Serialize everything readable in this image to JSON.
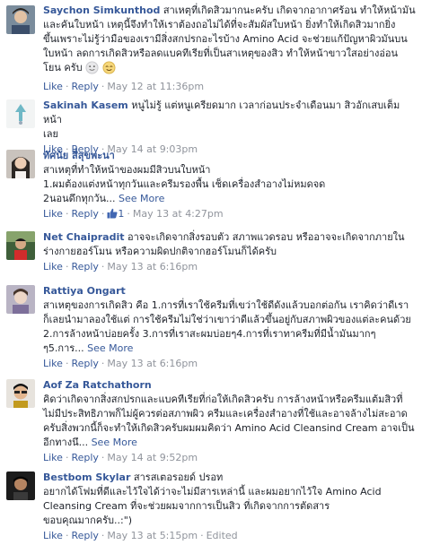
{
  "comments": [
    {
      "name": "Saychon Simkunthod",
      "lines": [
        "สาเหตุที่เกิดสิวมากนะครับ เกิดจากอากาศร้อน ทำให้หน้ามัน",
        "และคันใบหน้า เหตุนี้จึงทำให้เราต้องถอไม่ได้ที่จะสัมผัสใบหน้า ยิ่งทำให้เกิดสิวมากยิ่ง",
        "ขึ้นเพราะไม่รู้ว่ามือของเรามีสิ่งสกปรกอะไรบ้าง Amino Acid จะช่วยแก้ปัญหาผิวมันบน",
        "ใบหน้า ลดการเกิดสิวหรือลดแบคทีเรียที่เป็นสาเหตุของสิว ทำให้หน้าขาวใสอย่างอ่อน",
        "โยน ครับ"
      ],
      "like": "Like",
      "reply": "Reply",
      "time": "May 12 at 11:36pm"
    },
    {
      "name": "Sakinah Kasem",
      "lines": [
        "หนูไม่รู้ แต่หนูเครียดมาก เวลาก่อนประจำเดือนมา สิวอักเสบเต็มหน้า",
        "เลย"
      ],
      "like": "Like",
      "reply": "Reply",
      "time": "May 14 at 9:03pm"
    },
    {
      "name": "ทัศนัย สี่สุขพะนา",
      "lines": [
        "สาเหตุที่ทำให้หน้าของผมมีสิวบนใบหน้า",
        "1.ผมต้องแต่งหน้าทุกวันและครีมรองพื้น เช็ดเครื่องสำอางไม่หมดจด",
        "2นอนดึกทุกวัน..."
      ],
      "see_more": "See More",
      "like": "Like",
      "reply": "Reply",
      "like_count": "1",
      "time": "May 13 at 4:27pm"
    },
    {
      "name": "Net Chaipradit",
      "lines": [
        "อาจจะเกิดจากสิ่งรอบตัว สภาพแวดรอบ หรืออาจจะเกิดจากภายใน",
        "ร่างกายฮอร์โมน หรือความผิดปกติจากฮอร์โมนก็ได้ครับ"
      ],
      "like": "Like",
      "reply": "Reply",
      "time": "May 13 at 6:16pm"
    },
    {
      "name": "Rattiya Ongart",
      "lines": [
        "สาเหตุของการเกิดสิว คือ 1.การที่เราใช้ครีมที่เขว่าใช้ดีดังแล้วบอกต่อกัน เราคิดว่าดีเรา",
        "ก็เลยนำมาลองใช้แต่ การใช้ครีมไม่ใช่ว่าเขาว่าดีแล้วขึ้นอยู่กับสภาพผิวของแต่ละคนด้วย",
        "2.การล้างหน้าบ่อยครั้ง 3.การที่เราสะผมบ่อยๆ4.การที่เราทาครีมที่มีน้ำมันมากๆ",
        "ๆ5.การ..."
      ],
      "see_more": "See More",
      "like": "Like",
      "reply": "Reply",
      "time": "May 13 at 6:16pm"
    },
    {
      "name": "Aof Za Ratchathorn",
      "lines": [
        "คิดว่าเกิดจากสิ่งสกปรกและแบคทีเรียที่ก่อให้เกิดสิวครับ การล้างหน้าหรือครีมแต้มสิวที่",
        "ไม่มีประสิทธิภาพก็ไม่ผู้ควรต่อสภาพผิว ครีมและเครื่องสำอางที่ใช้และอาจล้างไม่สะอาด",
        "ครับสิ่งพวกนี้ก็จะทำให้เกิดสิวครับผมผมคิดว่า Amino Acid Cleansind Cream อาจเป็น",
        "อีกทางนึ..."
      ],
      "see_more": "See More",
      "like": "Like",
      "reply": "Reply",
      "time": "May 14 at 9:52pm"
    },
    {
      "name": "Bestbom Skylar",
      "lines": [
        "สารสเตอรอยด์ ปรอท",
        "อยากได้โฟมที่ดีและไว้ใจได้ว่าจะไม่มีสารเหล่านี้ และผมอยากไว้ใจ Amino Acid",
        "Cleansing Cream ที่จะช่วยผมจากการเป็นสิว ที่เกิดจากการตัดสาร",
        "ขอบคุณมากครับ..:\")"
      ],
      "like": "Like",
      "reply": "Reply",
      "time": "May 13 at 5:15pm",
      "edited": "Edited"
    }
  ],
  "icons": {
    "thumb": "thumbs-up-icon",
    "emoji": "smiley-emoji-icon"
  },
  "colors": {
    "link": "#365899",
    "text": "#1d2129",
    "meta": "#90949c"
  }
}
